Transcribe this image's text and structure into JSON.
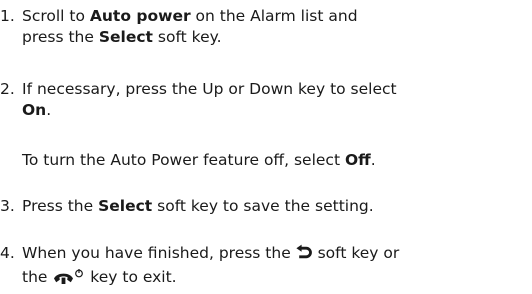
{
  "steps": [
    {
      "number": "1.",
      "lines": [
        {
          "t1": "Scroll to ",
          "b1": "Auto power",
          "t2": " on the Alarm list and"
        },
        {
          "t1": "press the ",
          "b1": "Select",
          "t2": " soft key."
        }
      ]
    },
    {
      "number": "2.",
      "lines": [
        {
          "t1": "If necessary, press the Up or Down key to select"
        },
        {
          "b1": "On",
          "t2": "."
        }
      ],
      "note": {
        "t1": "To turn the Auto Power feature off, select ",
        "b1": "Off",
        "t2": "."
      }
    },
    {
      "number": "3.",
      "lines": [
        {
          "t1": "Press the ",
          "b1": "Select",
          "t2": " soft key to save the setting."
        }
      ]
    },
    {
      "number": "4.",
      "lines": [
        {
          "t1": "When you have finished, press the ",
          "t2": " soft key or"
        },
        {
          "t1": "the ",
          "t2": " key to exit."
        }
      ],
      "icons": {
        "back": "back-arrow-icon",
        "end": "end-call-power-icon"
      }
    }
  ]
}
